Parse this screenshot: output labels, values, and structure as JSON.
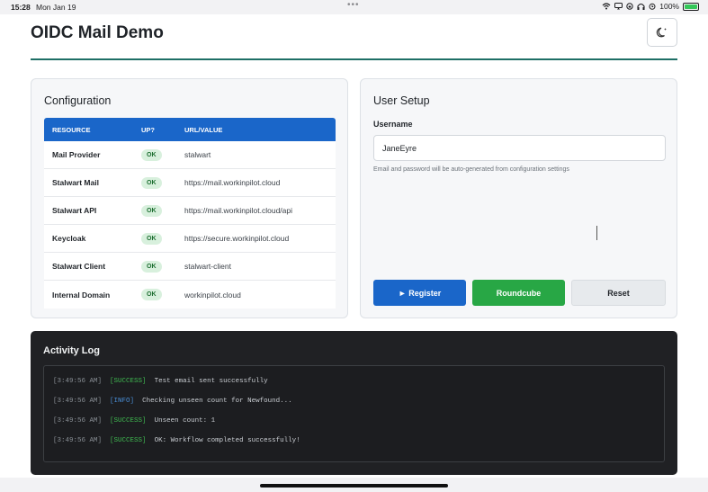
{
  "status_bar": {
    "time": "15:28",
    "date": "Mon Jan 19",
    "battery": "100%"
  },
  "app": {
    "title": "OIDC Mail Demo",
    "accent_color": "#1a66c9",
    "divider_color": "#1e6f66"
  },
  "config": {
    "title": "Configuration",
    "columns": [
      "RESOURCE",
      "UP?",
      "URL/VALUE"
    ],
    "rows": [
      {
        "resource": "Mail Provider",
        "status": "OK",
        "value": "stalwart"
      },
      {
        "resource": "Stalwart Mail",
        "status": "OK",
        "value": "https://mail.workinpilot.cloud"
      },
      {
        "resource": "Stalwart API",
        "status": "OK",
        "value": "https://mail.workinpilot.cloud/api"
      },
      {
        "resource": "Keycloak",
        "status": "OK",
        "value": "https://secure.workinpilot.cloud"
      },
      {
        "resource": "Stalwart Client",
        "status": "OK",
        "value": "stalwart-client"
      },
      {
        "resource": "Internal Domain",
        "status": "OK",
        "value": "workinpilot.cloud"
      }
    ]
  },
  "user_setup": {
    "title": "User Setup",
    "username_label": "Username",
    "username_value": "JaneEyre",
    "hint": "Email and password will be auto-generated from configuration settings",
    "register_label": "► Register",
    "roundcube_label": "Roundcube",
    "reset_label": "Reset"
  },
  "activity_log": {
    "title": "Activity Log",
    "entries": [
      {
        "time": "[3:49:56 AM]",
        "level": "[SUCCESS]",
        "message": "Test email sent successfully"
      },
      {
        "time": "[3:49:56 AM]",
        "level": "[INFO]",
        "message": "Checking unseen count for Newfound..."
      },
      {
        "time": "[3:49:56 AM]",
        "level": "[SUCCESS]",
        "message": "Unseen count: 1"
      },
      {
        "time": "[3:49:56 AM]",
        "level": "[SUCCESS]",
        "message": "OK: Workflow completed successfully!"
      }
    ]
  },
  "icons": {
    "theme_toggle": "moon-icon",
    "wifi": "wifi-icon",
    "battery": "battery-icon"
  }
}
